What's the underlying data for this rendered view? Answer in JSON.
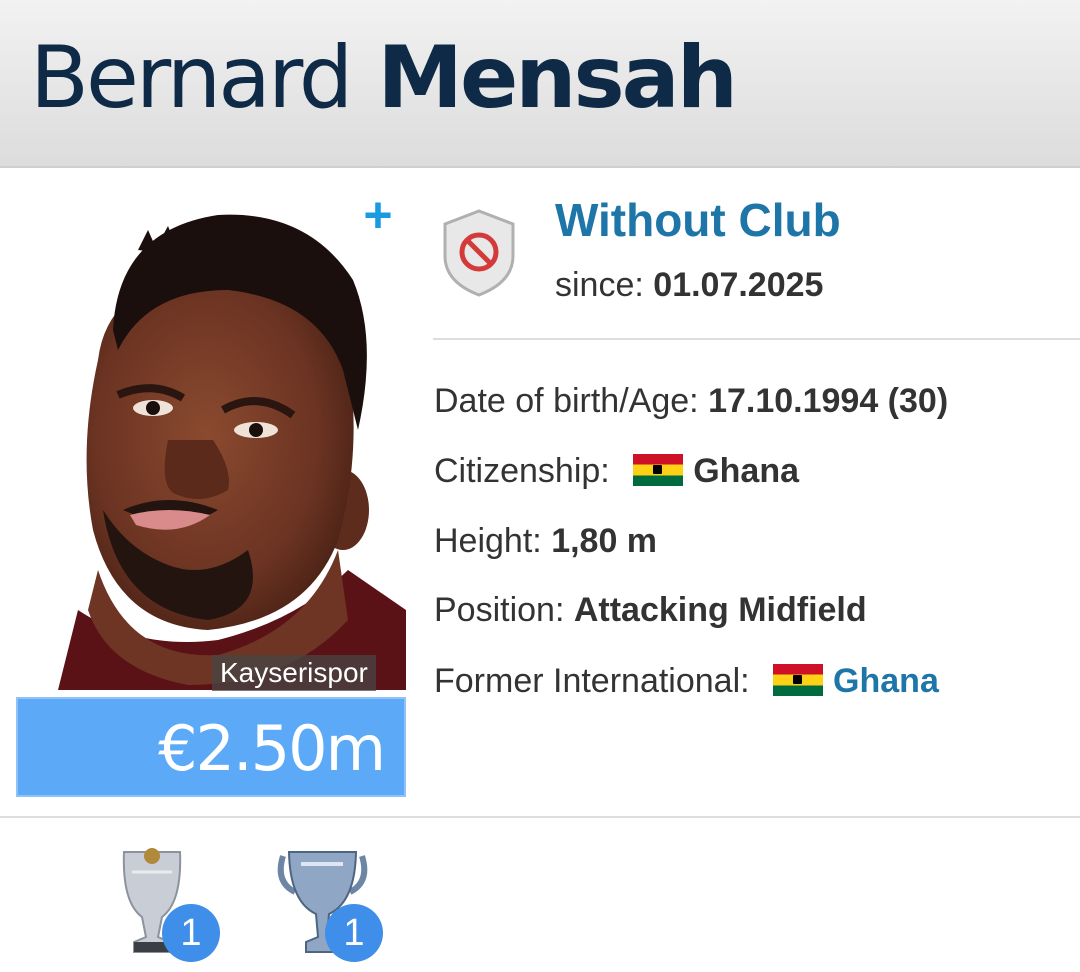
{
  "header": {
    "first_name": "Bernard",
    "last_name": "Mensah"
  },
  "photo": {
    "club_label": "Kayserispor",
    "add_icon": "plus-icon"
  },
  "market_value": "€2.50m",
  "club": {
    "name": "Without Club",
    "since_label": "since:",
    "since_value": "01.07.2025",
    "crest_icon": "no-club-crest-icon"
  },
  "info": {
    "dob_label": "Date of birth/Age:",
    "dob_value": "17.10.1994 (30)",
    "citizenship_label": "Citizenship:",
    "citizenship_value": "Ghana",
    "height_label": "Height:",
    "height_value": "1,80 m",
    "position_label": "Position:",
    "position_value": "Attacking Midfield",
    "former_intl_label": "Former International:",
    "former_intl_value": "Ghana"
  },
  "trophies": [
    {
      "icon": "league-trophy-icon",
      "count": "1"
    },
    {
      "icon": "cup-trophy-icon",
      "count": "1"
    }
  ],
  "colors": {
    "accent": "#1d75a8",
    "value_bg": "#5ca9f7",
    "badge": "#3f8ee9",
    "name": "#0e2a47"
  }
}
